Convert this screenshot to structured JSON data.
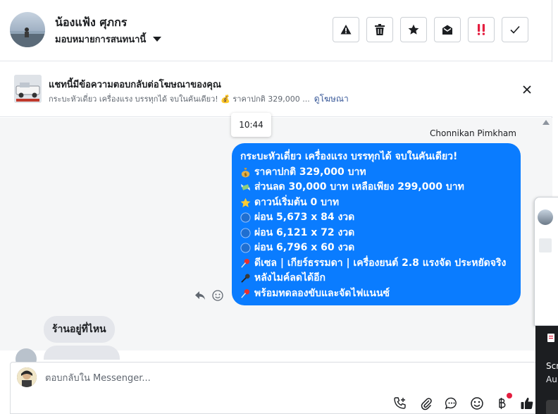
{
  "header": {
    "contact_name": "น้องแฟ้ง ศุภกร",
    "assign_label": "มอบหมายการสนทนานี้",
    "tools": [
      {
        "icon": "warning-icon",
        "color": "#1c1e21"
      },
      {
        "icon": "trash-icon",
        "color": "#1c1e21"
      },
      {
        "icon": "star-icon",
        "color": "#1c1e21"
      },
      {
        "icon": "envelope-open-icon",
        "color": "#1c1e21"
      },
      {
        "icon": "double-exclamation-icon",
        "color": "#e41e3f"
      },
      {
        "icon": "check-icon",
        "color": "#1c1e21"
      }
    ]
  },
  "ad": {
    "title": "แชทนี้มีข้อความตอบกลับต่อโฆษณาของคุณ",
    "description": "กระบะหัวเดี่ยว เครื่องแรง บรรทุกได้ จบในคันเดียว! 💰 ราคาปกติ 329,000 ...",
    "link": "ดูโฆษณา"
  },
  "chat": {
    "timestamp": "10:44",
    "sender": "Chonnikan Pimkham",
    "outgoing_lines": [
      {
        "icon": "",
        "text": "กระบะหัวเดี่ยว เครื่องแรง บรรทุกได้ จบในคันเดียว!"
      },
      {
        "icon": "money-bag-icon",
        "text": "ราคาปกติ 329,000 บาท"
      },
      {
        "icon": "money-wings-icon",
        "text": "ส่วนลด 30,000 บาท เหลือเพียง 299,000 บาท"
      },
      {
        "icon": "star-emoji-icon",
        "text": "ดาวน์เริ่มต้น 0 บาท"
      },
      {
        "icon": "blue-circle-icon",
        "text": "ผ่อน 5,673 x 84 งวด"
      },
      {
        "icon": "blue-circle-icon",
        "text": "ผ่อน 6,121 x 72 งวด"
      },
      {
        "icon": "blue-circle-icon",
        "text": "ผ่อน 6,796 x 60 งวด"
      },
      {
        "icon": "pushpin-icon",
        "text": "ดีเซล | เกียร์ธรรมดา | เครื่องยนต์ 2.8 แรงจัด ประหยัดจริง"
      },
      {
        "icon": "microphone-icon",
        "text": "หลังไมค์ลดได้อีก"
      },
      {
        "icon": "pushpin-icon",
        "text": "พร้อมทดลองขับและจัดไฟแนนซ์"
      }
    ],
    "incoming_message": "ร้านอยู่ที่ไหน"
  },
  "composer": {
    "placeholder": "ตอบกลับใน Messenger...",
    "icons": [
      "phone-plus-icon",
      "paperclip-icon",
      "saved-reply-icon",
      "emoji-icon",
      "baht-icon",
      "thumbs-up-icon"
    ],
    "notification_color": "#e41e3f"
  },
  "overlay": {
    "line1": "Scr",
    "line2": "Au"
  },
  "colors": {
    "accent": "#0a7cff",
    "link": "#385898",
    "alert": "#e41e3f"
  }
}
